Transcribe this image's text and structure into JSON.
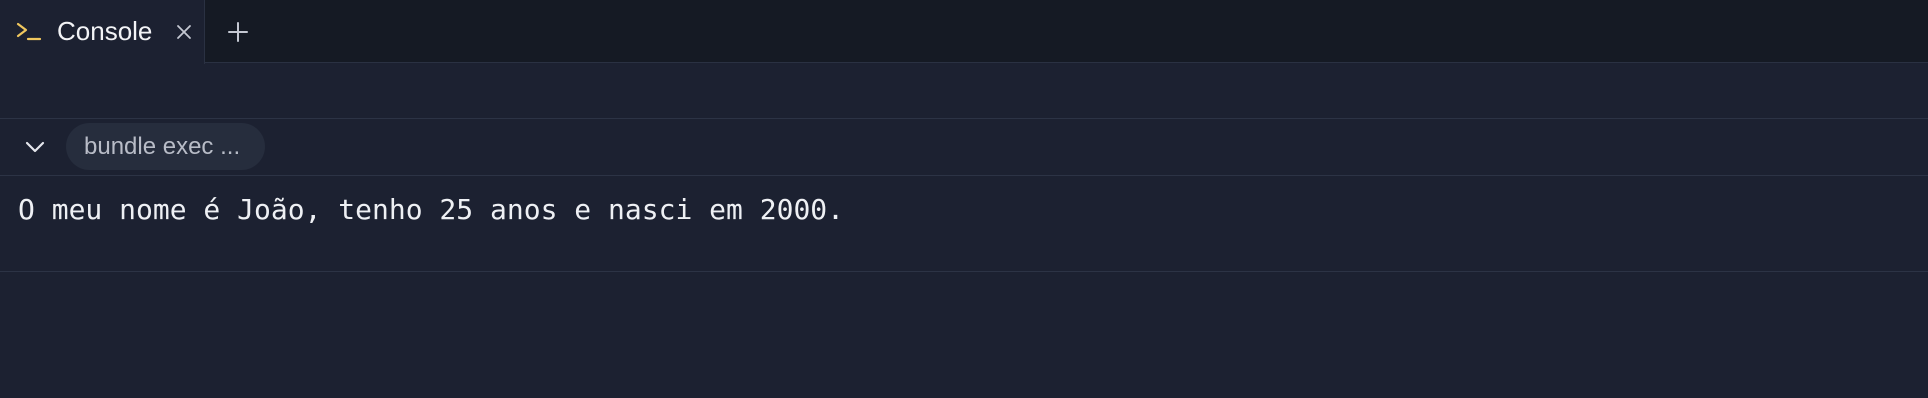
{
  "tabs": [
    {
      "label": "Console",
      "icon": "terminal-icon",
      "active": true
    }
  ],
  "toolbar": {
    "new_tab_icon": "plus-icon"
  },
  "command": {
    "label": "bundle exec ...",
    "collapse_icon": "chevron-down-icon"
  },
  "output": {
    "lines": [
      "O meu nome é João, tenho 25 anos e nasci em 2000."
    ]
  },
  "colors": {
    "background": "#1c2131",
    "tabbar_background": "#151a24",
    "prompt_accent": "#f0c75e",
    "text": "#eef0f4"
  }
}
